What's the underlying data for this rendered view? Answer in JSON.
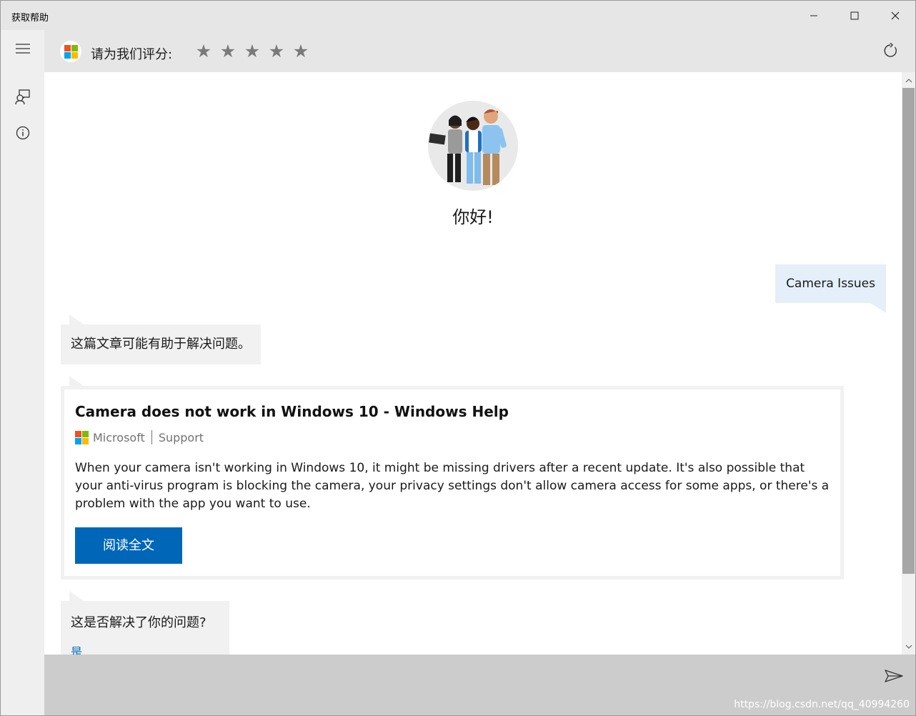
{
  "window": {
    "title": "获取帮助"
  },
  "header": {
    "rate_label": "请为我们评分:",
    "stars": [
      "★",
      "★",
      "★",
      "★",
      "★"
    ]
  },
  "chat": {
    "greeting": "你好!",
    "user_message": "Camera Issues",
    "bot_message_1": "这篇文章可能有助于解决问题。",
    "card": {
      "title": "Camera does not work in Windows 10 - Windows Help",
      "source_brand": "Microsoft",
      "source_section": "Support",
      "description": "When your camera isn't working in Windows 10, it might be missing drivers after a recent update. It's also possible that your anti-virus program is blocking the camera, your privacy settings don't allow camera access for some apps, or there's a problem with the app you want to use.",
      "read_button": "阅读全文"
    },
    "bot_message_2": "这是否解决了你的问题?",
    "bot_option_yes": "是"
  },
  "watermark": "https://blog.csdn.net/qq_40994260",
  "colors": {
    "accent": "#0067b8",
    "user_bubble": "#e4eff9",
    "bot_bubble": "#f1f1f1",
    "ms_red": "#f25022",
    "ms_green": "#7fba00",
    "ms_blue": "#00a4ef",
    "ms_yellow": "#ffb900"
  },
  "icons": {
    "menu": "hamburger-icon",
    "feedback": "feedback-icon",
    "info": "info-icon",
    "refresh": "refresh-icon",
    "send": "send-icon"
  }
}
